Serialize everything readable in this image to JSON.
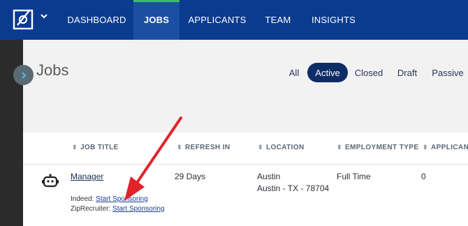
{
  "nav": {
    "items": [
      {
        "label": "DASHBOARD"
      },
      {
        "label": "JOBS"
      },
      {
        "label": "APPLICANTS"
      },
      {
        "label": "TEAM"
      },
      {
        "label": "INSIGHTS"
      }
    ],
    "active": "JOBS"
  },
  "page": {
    "title": "Jobs",
    "filters": [
      {
        "label": "All"
      },
      {
        "label": "Active"
      },
      {
        "label": "Closed"
      },
      {
        "label": "Draft"
      },
      {
        "label": "Passive"
      }
    ],
    "active_filter": "Active"
  },
  "table": {
    "headers": [
      {
        "label": "JOB TITLE"
      },
      {
        "label": "REFRESH IN"
      },
      {
        "label": "LOCATION"
      },
      {
        "label": "EMPLOYMENT TYPE"
      },
      {
        "label": "APPLICANT"
      }
    ],
    "rows": [
      {
        "title": "Manager",
        "refresh_in": "29 Days",
        "location_city": "Austin",
        "location_full": "Austin - TX - 78704",
        "employment_type": "Full Time",
        "applicants": "0",
        "indeed_label": "Indeed:",
        "indeed_action": "Start Sponsoring",
        "ziprecruiter_label": "ZipRecruiter:",
        "ziprecruiter_action": "Start Sponsoring"
      }
    ]
  },
  "colors": {
    "nav_bg": "#0a3b8f",
    "nav_active_bg": "#1b4fa3",
    "nav_active_indicator": "#3fbf5a",
    "filter_active_bg": "#0e2c66",
    "annotation_arrow": "#e0242a"
  },
  "icons": [
    "logo-icon",
    "chevron-down-icon",
    "chevron-right-icon",
    "sort-icon",
    "robot-icon",
    "annotation-arrow"
  ]
}
